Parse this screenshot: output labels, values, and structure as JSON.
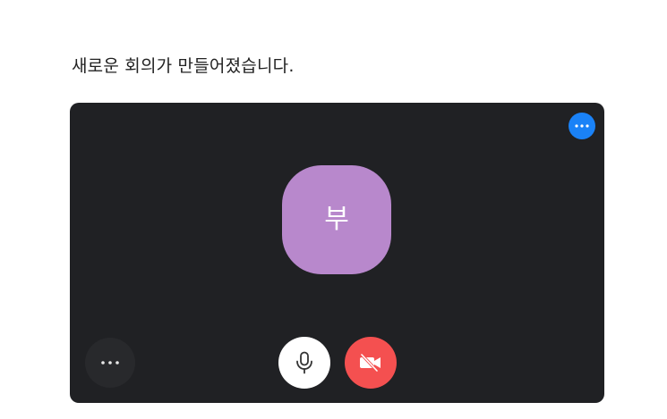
{
  "heading": "새로운 회의가 만들어졌습니다.",
  "preview": {
    "avatar_initial": "부",
    "avatar_color": "#b888cc",
    "background_color": "#202124"
  },
  "controls": {
    "corner_menu_icon": "more-horizontal-icon",
    "corner_menu_color": "#1a82f7",
    "more_icon": "more-horizontal-icon",
    "mic_icon": "microphone-icon",
    "camera_icon": "video-off-icon",
    "camera_button_color": "#f45050"
  }
}
